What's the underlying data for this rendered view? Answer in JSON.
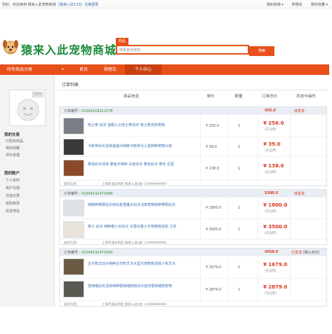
{
  "topbar": {
    "welcome_prefix": "您好，欢迎来到 猿来入此宠物商城",
    "login_text": "[猿来入此123]",
    "logout_text": "注销登录",
    "links": [
      "我的商城 ▾",
      "购物车",
      "我的收藏 ▾"
    ]
  },
  "header": {
    "logo_text": "猿来入此宠物商城",
    "search_tab": "商品",
    "search_placeholder": "搜索其他宠物",
    "search_button": "搜索"
  },
  "nav": {
    "category_label": "所有商品分类",
    "category_arrow": "▾",
    "items": [
      "首页",
      "购物车",
      "个人中心"
    ]
  },
  "sidebar": {
    "avatar_badge": "更换图",
    "sections": [
      {
        "title": "我的交易",
        "links": [
          "已购买商品",
          "我的收藏",
          "评价管理"
        ]
      },
      {
        "title": "我的账户",
        "links": [
          "个人资料",
          "用户充值",
          "充值记录",
          "密码修改",
          "收货地址"
        ]
      }
    ]
  },
  "main": {
    "heading": "订单列表",
    "columns": [
      "商品信息",
      "单价",
      "数量",
      "订单总价",
      "状态与操作"
    ],
    "orders": [
      {
        "label": "订单编号：",
        "number": "01594218221576",
        "total": "455.0",
        "status": "待发货",
        "items": [
          {
            "name": "哈士奇 幼犬 蓝眼三火哈士奇幼犬 哈士奇活体宠物",
            "price": "¥ 256.0",
            "qty": "1",
            "subtotal": "¥ 256.0",
            "note": "(先运费)",
            "thumb_color": "#7a7e86"
          },
          {
            "name": "卡斯罗幼犬活体黑狼犬纯种卡斯罗大小型纯种宠物公狗",
            "price": "¥ 39.0",
            "qty": "1",
            "subtotal": "¥ 39.0",
            "note": "(先运费)",
            "thumb_color": "#3c3a38"
          },
          {
            "name": "泰迪幼犬活体 泰迪犬纯种 白色幼犬 泰迪幼犬 卷毛 巨型",
            "price": "¥ 138.0",
            "qty": "1",
            "subtotal": "¥ 138.0",
            "note": "(先运费)",
            "thumb_color": "#8a4a2a"
          }
        ],
        "footer": [
          "收货信息：",
          "上海市浦东新区 猿来入此(收) 13999999999"
        ]
      },
      {
        "label": "订单编号：",
        "number": "01594131471989",
        "total": "5300.0",
        "status": "待发货",
        "items": [
          {
            "name": "纯种萨摩耶幼犬纯白色雪橇犬幼犬活体宠物狗萨摩耶幼犬",
            "price": "¥ 1800.0",
            "qty": "1",
            "subtotal": "¥ 1800.0",
            "note": "(先运费)",
            "thumb_color": "#dfe2e6"
          },
          {
            "name": "卷小 幼犬 纯种卷小犬幼犬 冰雪白卷小犬宠物狗活体 江苏",
            "price": "¥ 3500.0",
            "qty": "1",
            "subtotal": "¥ 3500.0",
            "note": "(先运费)",
            "thumb_color": "#e8e4dc"
          }
        ],
        "footer": [
          "收货信息：",
          "上海市浦东新区 猿来入此(收) 13999999999"
        ]
      },
      {
        "label": "订单编号：",
        "number": "01594131471563",
        "total": "4558.0",
        "status": "已发货",
        "status_action": "[确认收货]",
        "items": [
          {
            "name": "古代牧羊幼犬纯种古代牧羊犬大型犬宠物狗活体小牧羊犬",
            "price": "¥ 1679.0",
            "qty": "1",
            "subtotal": "¥ 1679.0",
            "note": "(先运费)",
            "thumb_color": "#6b5a44"
          },
          {
            "name": "雪纳瑞幼犬活体纯种雪纳瑞狗狗幼犬迷你雪纳瑞狗宠物",
            "price": "¥ 2879.0",
            "qty": "1",
            "subtotal": "¥ 2879.0",
            "note": "(先运费)",
            "thumb_color": "#5a5a52"
          }
        ],
        "footer": [
          "收货信息：",
          "上海市浦东新区 猿来入此(收) 13999999999"
        ]
      }
    ]
  },
  "colors": {
    "accent": "#e8501a",
    "price_red": "#d9381e",
    "link_blue": "#3a6fb5",
    "logo_green": "#1a8a3a"
  }
}
